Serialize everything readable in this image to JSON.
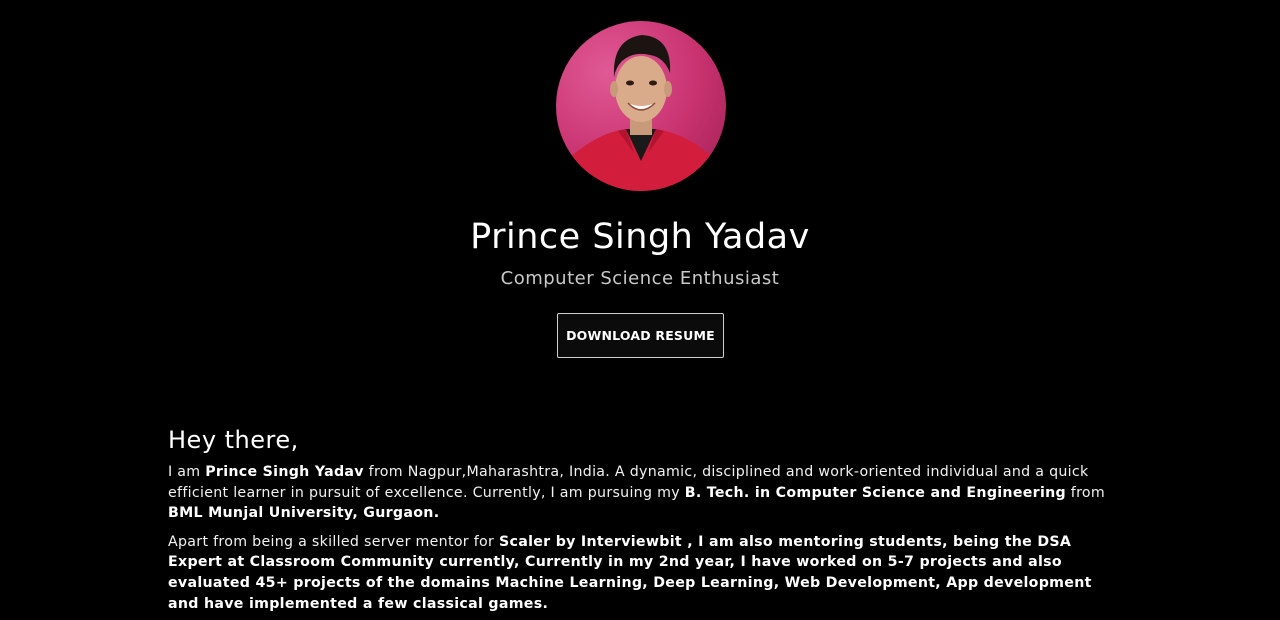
{
  "profile": {
    "avatar_alt": "profile photo",
    "name": "Prince Singh Yadav",
    "tagline": "Computer Science Enthusiast",
    "resume_button": "DOWNLOAD RESUME"
  },
  "about": {
    "heading": "Hey there,",
    "p1": {
      "t1": "I am ",
      "b1": "Prince Singh Yadav",
      "t2": " from Nagpur,Maharashtra, India. A dynamic, disciplined and work-oriented individual and a quick efficient learner in pursuit of excellence. Currently, I am pursuing my ",
      "b2": "B. Tech. in Computer Science and Engineering",
      "t3": " from ",
      "b3": "BML Munjal University, Gurgaon."
    },
    "p2": {
      "t1": "Apart from being a skilled server mentor for ",
      "b1": "Scaler by Interviewbit , I am also mentoring students, being the DSA Expert at Classroom Community currently, Currently in my 2nd year, I have worked on 5-7 projects and also evaluated 45+ projects of the domains Machine Learning, Deep Learning, Web Development, App development and have implemented a few classical games."
    }
  },
  "colors": {
    "background": "#000000",
    "text": "#ffffff",
    "tagline": "#c9c9c9",
    "avatar_bg": "#c8326f"
  }
}
